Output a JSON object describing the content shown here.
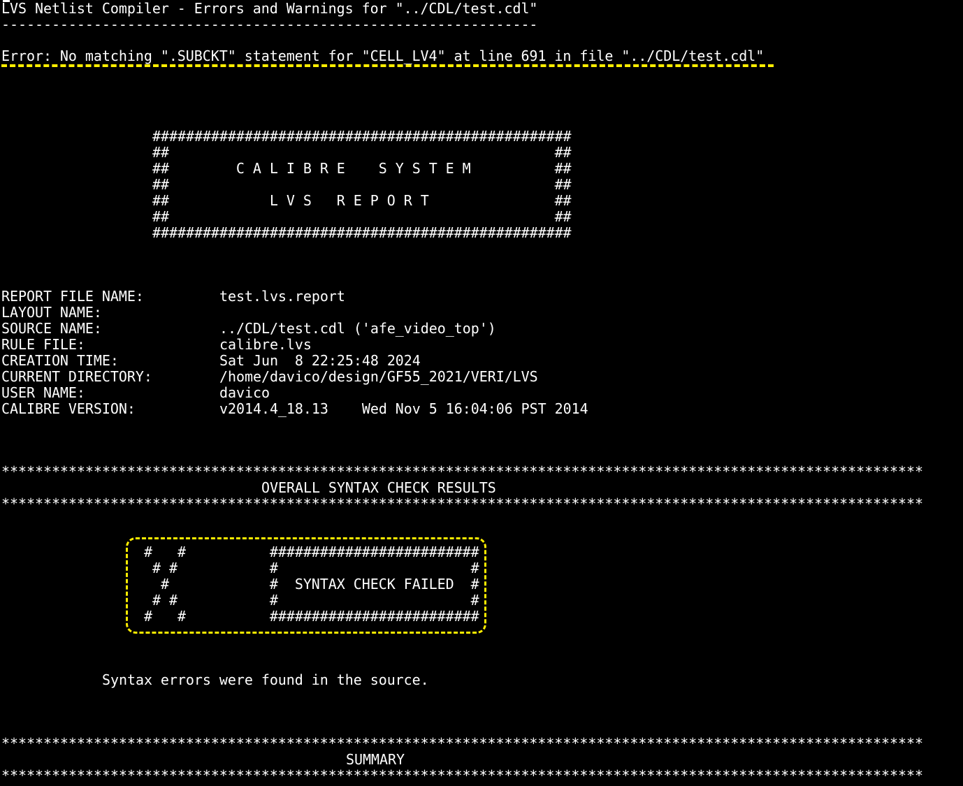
{
  "title_line": "LVS Netlist Compiler - Errors and Warnings for \"../CDL/test.cdl\"",
  "title_rule": "----------------------------------------------------------------",
  "error_line": "Error: No matching \".SUBCKT\" statement for \"CELL_LV4\" at line 691 in file \"../CDL/test.cdl\"",
  "banner": {
    "line1": "##################################################",
    "line2": "##                                              ##",
    "line3": "##        C A L I B R E    S Y S T E M          ##",
    "line4": "##                                              ##",
    "line5": "##            L V S   R E P O R T               ##",
    "line6": "##                                              ##",
    "line7": "##################################################"
  },
  "report_info": [
    {
      "label": "REPORT FILE NAME:",
      "value": "test.lvs.report"
    },
    {
      "label": "LAYOUT NAME:",
      "value": ""
    },
    {
      "label": "SOURCE NAME:",
      "value": "../CDL/test.cdl ('afe_video_top')"
    },
    {
      "label": "RULE FILE:",
      "value": "calibre.lvs"
    },
    {
      "label": "CREATION TIME:",
      "value": "Sat Jun  8 22:25:48 2024"
    },
    {
      "label": "CURRENT DIRECTORY:",
      "value": "/home/davico/design/GF55_2021/VERI/LVS"
    },
    {
      "label": "USER NAME:",
      "value": "davico"
    },
    {
      "label": "CALIBRE VERSION:",
      "value": "v2014.4_18.13    Wed Nov 5 16:04:06 PST 2014"
    }
  ],
  "star_rule": "**************************************************************************************************************",
  "syntax_section_title": "OVERALL SYNTAX CHECK RESULTS",
  "failed_banner": {
    "line1": " #   #          #########################",
    "line2": "  # #           #                       #",
    "line3": "   #            #  SYNTAX CHECK FAILED  #",
    "line4": "  # #           #                       #",
    "line5": " #   #          #########################"
  },
  "syntax_message": "Syntax errors were found in the source.",
  "summary_title": "SUMMARY",
  "colors": {
    "background": "#000000",
    "text": "#ffffff",
    "highlight": "#ffee00"
  }
}
